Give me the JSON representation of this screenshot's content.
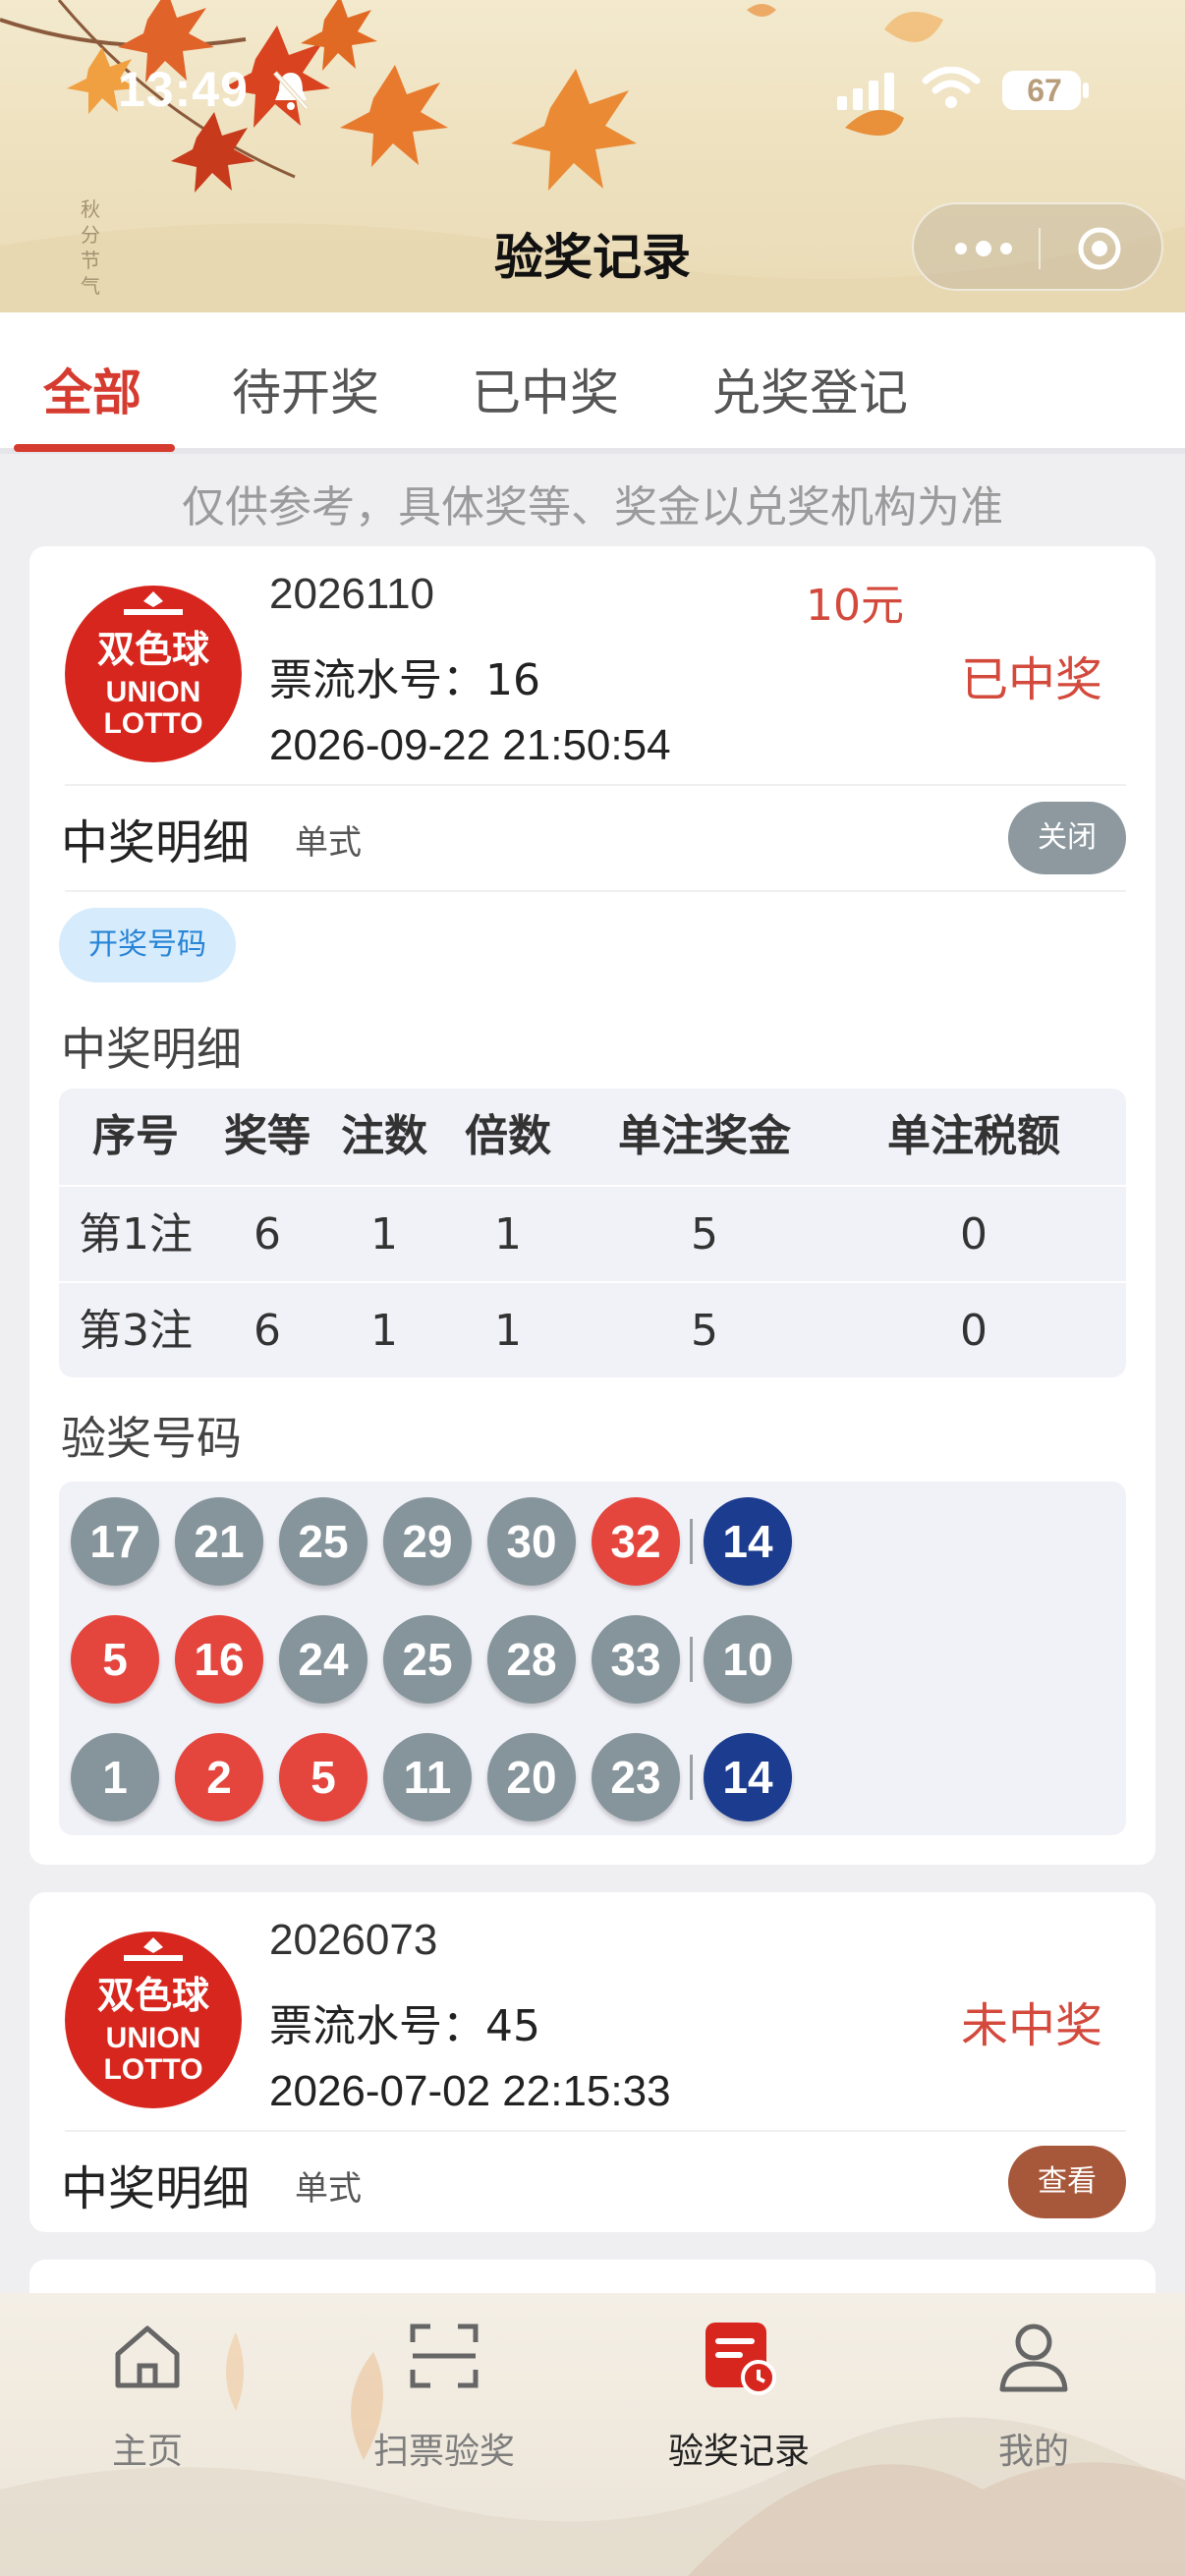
{
  "status_bar": {
    "time": "13:49",
    "battery": "67"
  },
  "header": {
    "title": "验奖记录",
    "seal_text": "秋分节气"
  },
  "tabs": [
    {
      "label": "全部",
      "active": true
    },
    {
      "label": "待开奖",
      "active": false
    },
    {
      "label": "已中奖",
      "active": false
    },
    {
      "label": "兑奖登记",
      "active": false
    }
  ],
  "notice": "仅供参考，具体奖等、奖金以兑奖机构为准",
  "logo": {
    "line1": "双色球",
    "line2": "UNION",
    "line3": "LOTTO"
  },
  "records": [
    {
      "issue": "2026110",
      "amount": "10元",
      "serial": "票流水号：16",
      "datetime": "2026-09-22 21:50:54",
      "status": "已中奖",
      "detail_label": "中奖明细",
      "type": "单式",
      "action": "关闭",
      "draw_chip": "开奖号码",
      "detail_section": "中奖明细",
      "table_headers": [
        "序号",
        "奖等",
        "注数",
        "倍数",
        "单注奖金",
        "单注税额"
      ],
      "table_rows": [
        [
          "第1注",
          "6",
          "1",
          "1",
          "5",
          "0"
        ],
        [
          "第3注",
          "6",
          "1",
          "1",
          "5",
          "0"
        ]
      ],
      "numbers_section": "验奖号码",
      "tickets": [
        {
          "red": [
            {
              "n": "17",
              "hit": false
            },
            {
              "n": "21",
              "hit": false
            },
            {
              "n": "25",
              "hit": false
            },
            {
              "n": "29",
              "hit": false
            },
            {
              "n": "30",
              "hit": false
            },
            {
              "n": "32",
              "hit": true
            }
          ],
          "blue": {
            "n": "14",
            "hit": true
          }
        },
        {
          "red": [
            {
              "n": "5",
              "hit": true
            },
            {
              "n": "16",
              "hit": true
            },
            {
              "n": "24",
              "hit": false
            },
            {
              "n": "25",
              "hit": false
            },
            {
              "n": "28",
              "hit": false
            },
            {
              "n": "33",
              "hit": false
            }
          ],
          "blue": {
            "n": "10",
            "hit": false
          }
        },
        {
          "red": [
            {
              "n": "1",
              "hit": false
            },
            {
              "n": "2",
              "hit": true
            },
            {
              "n": "5",
              "hit": true
            },
            {
              "n": "11",
              "hit": false
            },
            {
              "n": "20",
              "hit": false
            },
            {
              "n": "23",
              "hit": false
            }
          ],
          "blue": {
            "n": "14",
            "hit": true
          }
        }
      ]
    },
    {
      "issue": "2026073",
      "serial": "票流水号：45",
      "datetime": "2026-07-02 22:15:33",
      "status": "未中奖",
      "detail_label": "中奖明细",
      "type": "单式",
      "action": "查看"
    }
  ],
  "bottom_nav": [
    {
      "label": "主页",
      "icon": "home-icon",
      "active": false
    },
    {
      "label": "扫票验奖",
      "icon": "scan-icon",
      "active": false
    },
    {
      "label": "验奖记录",
      "icon": "records-icon",
      "active": true
    },
    {
      "label": "我的",
      "icon": "user-icon",
      "active": false
    }
  ],
  "colors": {
    "accent_red": "#d63b2f",
    "ball_red": "#e4463e",
    "ball_blue": "#1b3c8f",
    "ball_gray": "#86959b",
    "view_button": "#a8583a"
  }
}
